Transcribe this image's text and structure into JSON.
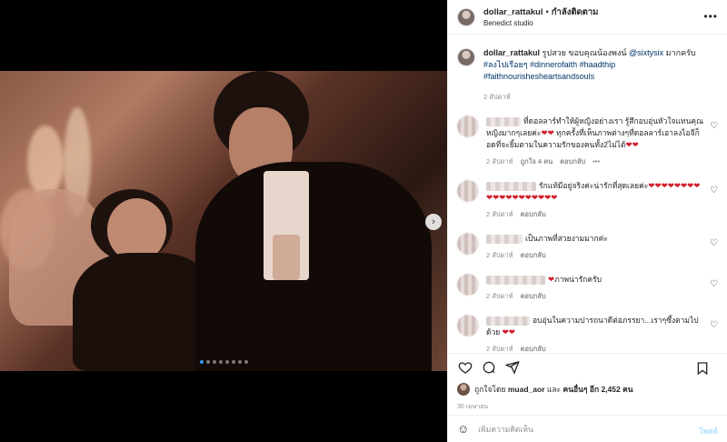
{
  "header": {
    "username": "dollar_rattakul",
    "separator": "•",
    "follow_label": "กำลังติดตาม",
    "location": "Benedict studio",
    "more_label": "•••"
  },
  "caption": {
    "username": "dollar_rattakul",
    "text_1": "รูปสวย ขอบคุณน้องพงน์",
    "mention": "@sixtysix",
    "text_2": "มากครับ",
    "tags": "#ลงไปเรือยๆ #dinnerofaith #haadthip #faithnourishesheartsandsouls",
    "time": "2 สัปดาห์"
  },
  "comments": [
    {
      "text": "ที่ดอลลาร์ทำให้ผู้หญิงอย่างเรา รู้สึกอบอุ่นหัวใจแทนคุณหญิงมากๆเลยค่ะ❤️❤️ ทุกครั้งที่เห็นภาพต่างๆที่ดอลลาร์เอาลงไอจีก็อดที่จะยิ้มตามในความรักของคนทั้ง2ไม่ได้❤️❤️",
      "time": "2 สัปดาห์",
      "likes": "ถูกใจ 4 คน",
      "reply": "ตอบกลับ",
      "extra": "•••"
    },
    {
      "text": "รักแท้มีอยู่จริงค่ะน่ารักที่สุดเลยค่ะ❤️❤️❤️❤️❤️❤️❤️❤️❤️❤️❤️❤️❤️❤️❤️❤️❤️❤️❤️",
      "time": "2 สัปดาห์",
      "reply": "ตอบกลับ"
    },
    {
      "text": "เป็นภาพที่สวยงามมากค่ะ",
      "time": "2 สัปดาห์",
      "reply": "ตอบกลับ"
    },
    {
      "text": "❤️ภาพน่ารักครับ",
      "time": "2 สัปดาห์",
      "reply": "ตอบกลับ"
    },
    {
      "text": "อบอุ่นในความปารถนาดีต่อภรรยา...เราๆซึ้งตามไปด้วย ❤️❤️",
      "time": "2 สัปดาห์",
      "reply": "ตอบกลับ"
    }
  ],
  "likes": {
    "prefix": "ถูกใจโดย",
    "user": "muad_aor",
    "middle": "และ",
    "others": "คนอื่นๆ อีก 2,452 คน"
  },
  "time_ago": "30 เมษายน",
  "add_comment": {
    "placeholder": "เพิ่มความคิดเห็น",
    "post_label": "โพสต์"
  },
  "carousel": {
    "total": 8,
    "active": 1
  },
  "colors": {
    "link": "#00376b",
    "heart": "#d01d2a",
    "post_disabled": "#b2dffc",
    "active_dot": "#3897f0"
  }
}
